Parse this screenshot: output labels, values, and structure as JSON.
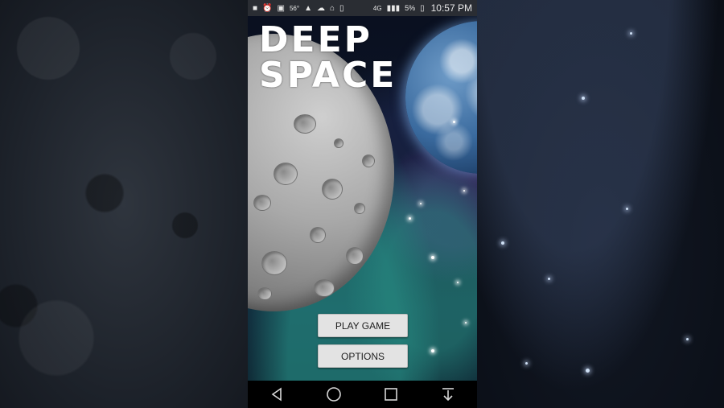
{
  "status_bar": {
    "icons": [
      "video-icon",
      "alarm-icon",
      "image-icon",
      "weather-icon",
      "drive-icon",
      "cloud-icon",
      "sync-icon",
      "vibrate-icon",
      "lte-icon",
      "signal-icon"
    ],
    "temperature": "56°",
    "network": "4G",
    "battery": "5%",
    "time": "10:57 PM"
  },
  "game": {
    "title_line1": "DEEP",
    "title_line2": "SPACE",
    "buttons": {
      "play": "PLAY GAME",
      "options": "OPTIONS"
    }
  },
  "nav_bar": {
    "icons": [
      "back-icon",
      "home-icon",
      "recents-icon",
      "notification-pull-icon"
    ]
  },
  "colors": {
    "button_bg": "#e3e3e3",
    "status_bar_bg": "#2a2d33",
    "nav_bar_bg": "#000000"
  }
}
